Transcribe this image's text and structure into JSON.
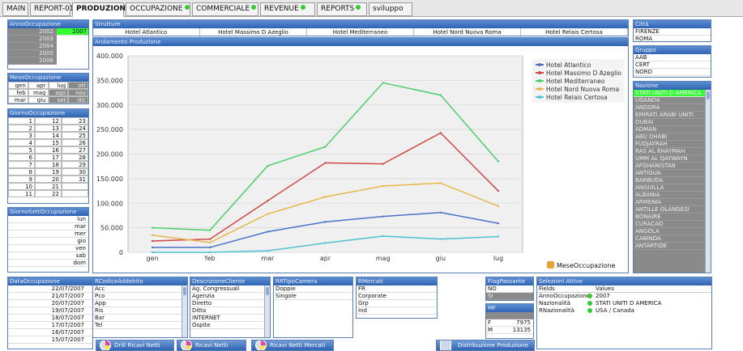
{
  "tabs": [
    {
      "label": "MAIN",
      "dot": false,
      "active": false
    },
    {
      "label": "REPORT-01",
      "dot": true,
      "active": false
    },
    {
      "label": "PRODUZIONE",
      "dot": false,
      "active": true
    },
    {
      "label": "OCCUPAZIONE",
      "dot": true,
      "active": false
    },
    {
      "label": "COMMERCIALE",
      "dot": true,
      "active": false
    },
    {
      "label": "REVENUE",
      "dot": true,
      "active": false
    },
    {
      "label": "REPORTS",
      "dot": true,
      "active": false
    },
    {
      "label": "sviluppo",
      "dot": false,
      "active": false
    }
  ],
  "anno": {
    "title": "AnnoOccupazione",
    "items": [
      {
        "v": "2002",
        "s": "ex"
      },
      {
        "v": "2003",
        "s": "ex"
      },
      {
        "v": "2004",
        "s": "ex"
      },
      {
        "v": "2005",
        "s": "ex"
      },
      {
        "v": "2006",
        "s": "ex"
      }
    ],
    "selected": "2007"
  },
  "mese": {
    "title": "MeseOccupazione",
    "cells": [
      [
        "gen",
        "apr",
        "lug",
        "ott"
      ],
      [
        "feb",
        "mag",
        "ago",
        "nov"
      ],
      [
        "mar",
        "giu",
        "set",
        "dic"
      ]
    ],
    "excluded": [
      "ott",
      "ago",
      "nov",
      "set",
      "dic"
    ]
  },
  "giorno": {
    "title": "GiornoOccupazione",
    "cells": [
      [
        "1",
        "12",
        "23"
      ],
      [
        "2",
        "13",
        "24"
      ],
      [
        "3",
        "14",
        "25"
      ],
      [
        "4",
        "15",
        "26"
      ],
      [
        "5",
        "16",
        "27"
      ],
      [
        "6",
        "17",
        "28"
      ],
      [
        "7",
        "18",
        "29"
      ],
      [
        "8",
        "19",
        "30"
      ],
      [
        "9",
        "20",
        "31"
      ],
      [
        "10",
        "21",
        ""
      ],
      [
        "11",
        "22",
        ""
      ]
    ]
  },
  "giornoSett": {
    "title": "GiornoSettOccupazione",
    "items": [
      "lun",
      "mar",
      "mer",
      "gio",
      "ven",
      "sab",
      "dom"
    ]
  },
  "strutture": {
    "title": "Strutture",
    "items": [
      "Hotel Atlantico",
      "Hotel Massimo D Azeglio",
      "Hotel Mediterraneo",
      "Hotel Nord Nuova Roma",
      "Hotel Relais Certosa"
    ]
  },
  "chart": {
    "title": "Andamento Produzione",
    "dimension_label": "MeseOccupazione"
  },
  "chart_data": {
    "type": "line",
    "categories": [
      "gen",
      "feb",
      "mar",
      "apr",
      "mag",
      "giu",
      "lug"
    ],
    "ylim": [
      0,
      400000
    ],
    "yticks": [
      "0",
      "50.000",
      "100.000",
      "150.000",
      "200.000",
      "250.000",
      "300.000",
      "350.000",
      "400.000"
    ],
    "grid": true,
    "legend": "top-right",
    "series": [
      {
        "name": "Hotel Atlantico",
        "color": "#4a72c8",
        "values": [
          10000,
          10000,
          42000,
          62000,
          73000,
          81000,
          59000
        ]
      },
      {
        "name": "Hotel Massimo D Azeglio",
        "color": "#d04848",
        "values": [
          23000,
          27000,
          105000,
          182000,
          180000,
          243000,
          125000
        ]
      },
      {
        "name": "Hotel Mediterraneo",
        "color": "#4ccf6a",
        "values": [
          50000,
          45000,
          176000,
          215000,
          345000,
          320000,
          185000
        ]
      },
      {
        "name": "Hotel Nord Nuova Roma",
        "color": "#e8b84c",
        "values": [
          35000,
          20000,
          78000,
          113000,
          135000,
          141000,
          94000
        ]
      },
      {
        "name": "Hotel Relais Certosa",
        "color": "#4ec2d4",
        "values": [
          0,
          0,
          3000,
          19000,
          33000,
          27000,
          32000
        ]
      }
    ]
  },
  "citta": {
    "title": "Città",
    "items": [
      "FIRENZE",
      "ROMA"
    ]
  },
  "gruppo": {
    "title": "Gruppo",
    "items": [
      "AAB",
      "CERT",
      "NORD"
    ]
  },
  "nazione": {
    "title": "Nazione",
    "selected": "STATI UNITI D AMERICA",
    "items": [
      "UGANDA",
      "ANDORA",
      "EMIRATI ARABI UNITI",
      "DUBAI",
      "ADMAN",
      "ABU DHABI",
      "FUDJAYRAH",
      "RAS AL KHAYMAH",
      "UMM AL QAYWAYN",
      "AFGHANISTAN",
      "ANTIGUA",
      "BARBUDA",
      "ANGUILLA",
      "ALBANIA",
      "ARMENIA",
      "ANTILLE OLANDESI",
      "BONAIRE",
      "CURACAO",
      "ANGOLA",
      "CABINDA",
      "ANTARTIDE"
    ]
  },
  "dataOcc": {
    "title": "DataOccupazione",
    "items": [
      "22/07/2007",
      "21/07/2007",
      "20/07/2007",
      "19/07/2007",
      "18/07/2007",
      "17/07/2007",
      "16/07/2007",
      "15/07/2007"
    ]
  },
  "codiceAdd": {
    "title": "RCodiceAddebito",
    "items": [
      "Acc",
      "Pco",
      "App",
      "Ris",
      "Bar",
      "Tel"
    ]
  },
  "descCliente": {
    "title": "DescrizioneCliente",
    "items": [
      "Ag. Congressuali",
      "Agenzia",
      "Diretto",
      "Ditta",
      "INTERNET",
      "Ospite"
    ]
  },
  "tipoCamera": {
    "title": "RRTipoCamera",
    "items": [
      "Doppie",
      "Singole"
    ]
  },
  "mercati": {
    "title": "RMercati",
    "items": [
      "FR",
      "Corporate",
      "Grp",
      "Ind"
    ]
  },
  "flag": {
    "title": "FlagPassante",
    "items": [
      "NO",
      "SI"
    ]
  },
  "mf": {
    "title": "MF",
    "rows": [
      [
        "F",
        "7975"
      ],
      [
        "M",
        "13135"
      ]
    ]
  },
  "selezioni": {
    "title": "Selezioni Attive",
    "h1": "Fields",
    "h2": "Values",
    "rows": [
      [
        "AnnoOccupazione",
        "2007"
      ],
      [
        "Nazionalità",
        "STATI UNITI D AMERICA"
      ],
      [
        "RNazionalità",
        "USA / Canada"
      ]
    ]
  },
  "buttons": {
    "b1": "Drill Ricavi Netti",
    "b2": "Ricavi Netti",
    "b3": "Ricavi Netti Mercati",
    "b4": "Distribuzione Produzione"
  }
}
